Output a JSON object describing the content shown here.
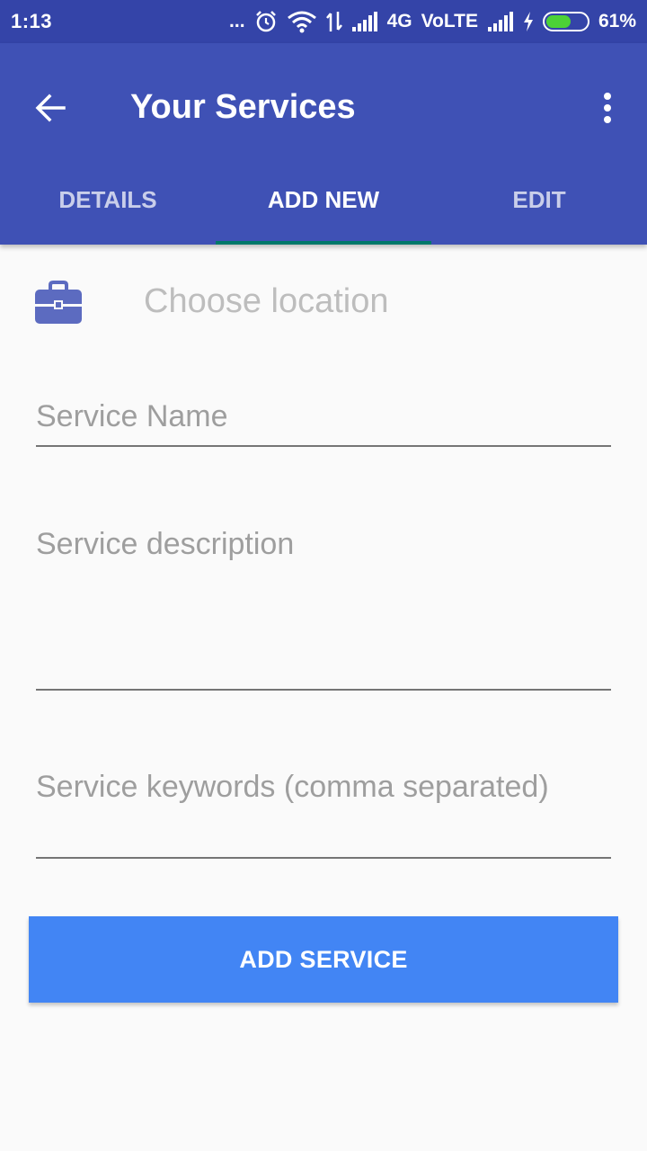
{
  "status_bar": {
    "time": "1:13",
    "dots": "...",
    "network": "4G",
    "volte": "VoLTE",
    "battery": "61%",
    "battery_level": 0.61,
    "icons": [
      "alarm-icon",
      "wifi-icon",
      "data-arrows-icon",
      "signal-icon",
      "charging-icon",
      "battery-icon"
    ]
  },
  "app_bar": {
    "title": "Your Services",
    "back_icon": "arrow-back-icon",
    "menu_icon": "more-vert-icon",
    "color": "#3f51b5"
  },
  "tabs": [
    {
      "label": "DETAILS",
      "active": false
    },
    {
      "label": "ADD NEW",
      "active": true
    },
    {
      "label": "EDIT",
      "active": false
    }
  ],
  "form": {
    "location_placeholder": "Choose location",
    "location_icon": "briefcase-icon",
    "service_name_placeholder": "Service Name",
    "service_description_placeholder": "Service description",
    "service_keywords_placeholder": "Service keywords (comma separated)",
    "submit_label": "ADD SERVICE",
    "accent_color": "#4285f4"
  }
}
